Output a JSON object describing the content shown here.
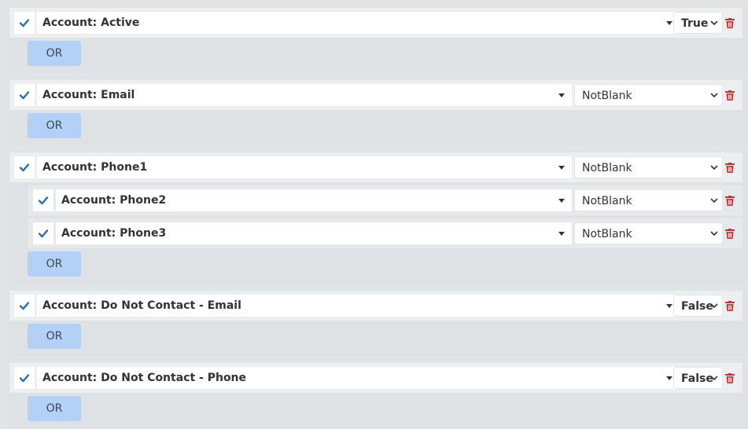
{
  "colors": {
    "check": "#2c6cb0",
    "trash": "#d62b2b",
    "or_button": "#b3d1f7",
    "background": "#e1e4e7"
  },
  "icons": {
    "check": "check-icon",
    "delete": "trash-icon",
    "field_dropdown": "caret-down-icon",
    "value_dropdown": "chevron-down-icon"
  },
  "groups": [
    {
      "rows": [
        {
          "field": "Account: Active",
          "value": "True"
        }
      ],
      "or_label": "OR"
    },
    {
      "rows": [
        {
          "field": "Account: Email",
          "value": "NotBlank"
        }
      ],
      "or_label": "OR"
    },
    {
      "rows": [
        {
          "field": "Account: Phone1",
          "value": "NotBlank"
        },
        {
          "field": "Account: Phone2",
          "value": "NotBlank"
        },
        {
          "field": "Account: Phone3",
          "value": "NotBlank"
        }
      ],
      "or_label": "OR"
    },
    {
      "rows": [
        {
          "field": "Account: Do Not Contact - Email",
          "value": "False"
        }
      ],
      "or_label": "OR"
    },
    {
      "rows": [
        {
          "field": "Account: Do Not Contact - Phone",
          "value": "False"
        }
      ],
      "or_label": "OR"
    }
  ]
}
